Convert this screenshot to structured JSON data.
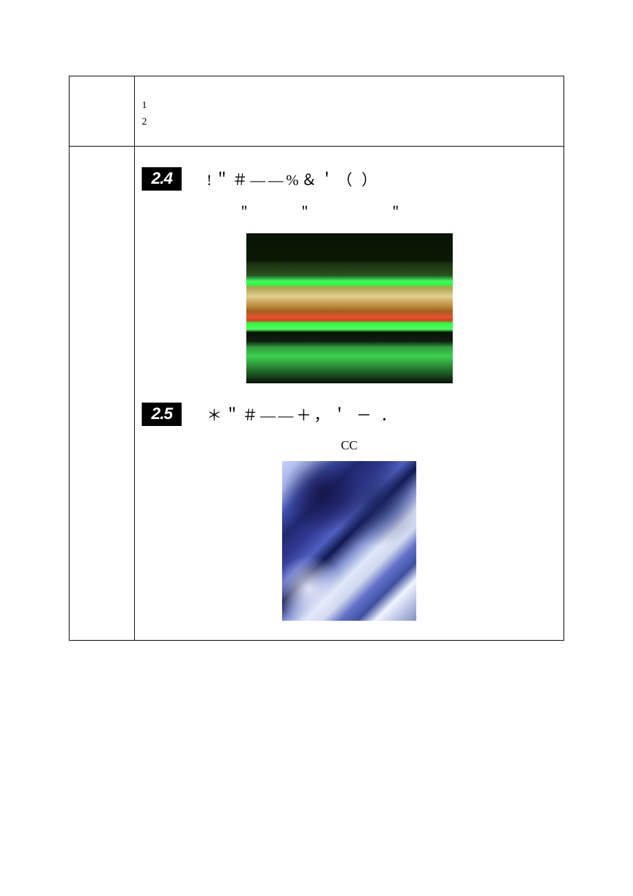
{
  "topList": {
    "line1": "1",
    "line2": "2"
  },
  "sections": [
    {
      "badge": "2.4",
      "title": "!＂＃——%＆＇（ ）",
      "sub": "＂　　　＂　　　　　＂"
    },
    {
      "badge": "2.5",
      "title": "＊＂＃——＋，＇ － ．",
      "cc": "CC"
    }
  ]
}
